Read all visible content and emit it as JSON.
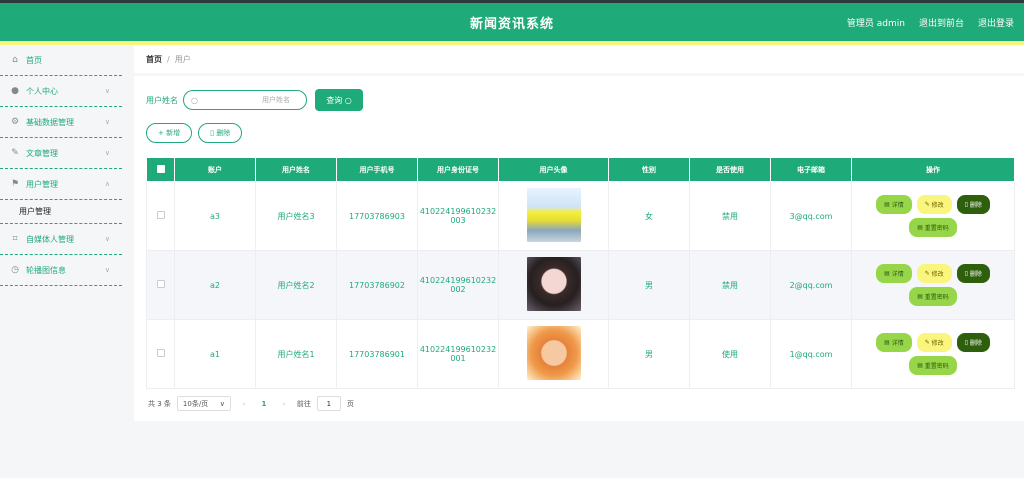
{
  "header": {
    "title": "新闻资讯系统",
    "admin_label": "管理员 admin",
    "exit_backend": "退出到前台",
    "logout": "退出登录",
    "brand_color": "#1faa79"
  },
  "sidebar": {
    "items": [
      {
        "label": "首页",
        "icon": "home-icon"
      },
      {
        "label": "个人中心",
        "icon": "user-icon"
      },
      {
        "label": "基础数据管理",
        "icon": "settings-icon"
      },
      {
        "label": "文章管理",
        "icon": "edit-icon"
      },
      {
        "label": "用户管理",
        "icon": "flag-icon"
      },
      {
        "label": "自媒体人管理",
        "icon": "crop-icon"
      },
      {
        "label": "轮播图信息",
        "icon": "clock-icon"
      }
    ],
    "sub_item": "用户管理"
  },
  "breadcrumb": {
    "home": "首页",
    "separator": "/",
    "current": "用户"
  },
  "search": {
    "label": "用户姓名",
    "placeholder": "用户姓名",
    "button": "查询"
  },
  "toolbar": {
    "add": "新增",
    "delete": "删除"
  },
  "table": {
    "columns": [
      "账户",
      "用户姓名",
      "用户手机号",
      "用户身份证号",
      "用户头像",
      "性别",
      "是否使用",
      "电子邮箱",
      "操作"
    ],
    "rows": [
      {
        "account": "a3",
        "name": "用户姓名3",
        "phone": "17703786903",
        "idcard1": "410224199610232",
        "idcard2": "003",
        "gender": "女",
        "status": "禁用",
        "email": "3@qq.com"
      },
      {
        "account": "a2",
        "name": "用户姓名2",
        "phone": "17703786902",
        "idcard1": "410224199610232",
        "idcard2": "002",
        "gender": "男",
        "status": "禁用",
        "email": "2@qq.com"
      },
      {
        "account": "a1",
        "name": "用户姓名1",
        "phone": "17703786901",
        "idcard1": "410224199610232",
        "idcard2": "001",
        "gender": "男",
        "status": "使用",
        "email": "1@qq.com"
      }
    ],
    "actions": {
      "detail": "详情",
      "edit": "修改",
      "delete": "删除",
      "reset": "重置密码"
    }
  },
  "pager": {
    "total": "共 3 条",
    "page_size": "10条/页",
    "current": "1",
    "goto": "前往",
    "goto_value": "1",
    "page_unit": "页"
  }
}
